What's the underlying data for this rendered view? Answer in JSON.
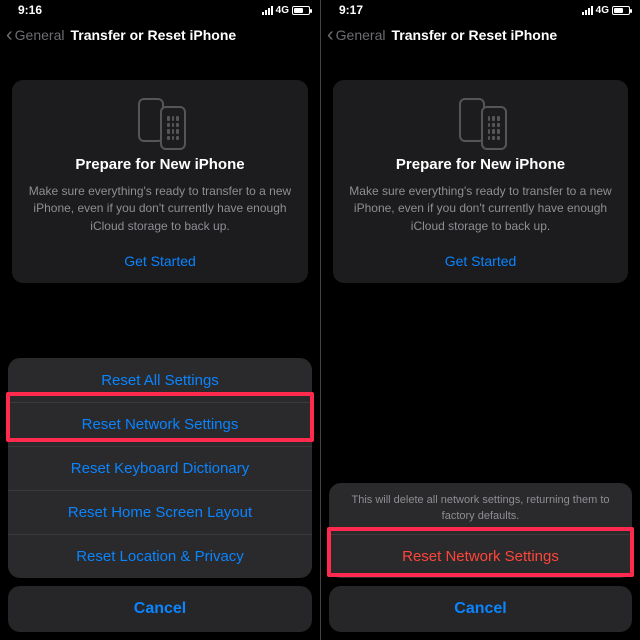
{
  "left": {
    "status": {
      "time": "9:16",
      "network": "4G"
    },
    "nav": {
      "back": "General",
      "title": "Transfer or Reset iPhone"
    },
    "card": {
      "heading": "Prepare for New iPhone",
      "body": "Make sure everything's ready to transfer to a new iPhone, even if you don't currently have enough iCloud storage to back up.",
      "cta": "Get Started"
    },
    "sheet": {
      "options": [
        "Reset All Settings",
        "Reset Network Settings",
        "Reset Keyboard Dictionary",
        "Reset Home Screen Layout",
        "Reset Location & Privacy"
      ],
      "cancel": "Cancel"
    }
  },
  "right": {
    "status": {
      "time": "9:17",
      "network": "4G"
    },
    "nav": {
      "back": "General",
      "title": "Transfer or Reset iPhone"
    },
    "card": {
      "heading": "Prepare for New iPhone",
      "body": "Make sure everything's ready to transfer to a new iPhone, even if you don't currently have enough iCloud storage to back up.",
      "cta": "Get Started"
    },
    "sheet": {
      "message": "This will delete all network settings, returning them to factory defaults.",
      "confirm": "Reset Network Settings",
      "cancel": "Cancel"
    }
  }
}
